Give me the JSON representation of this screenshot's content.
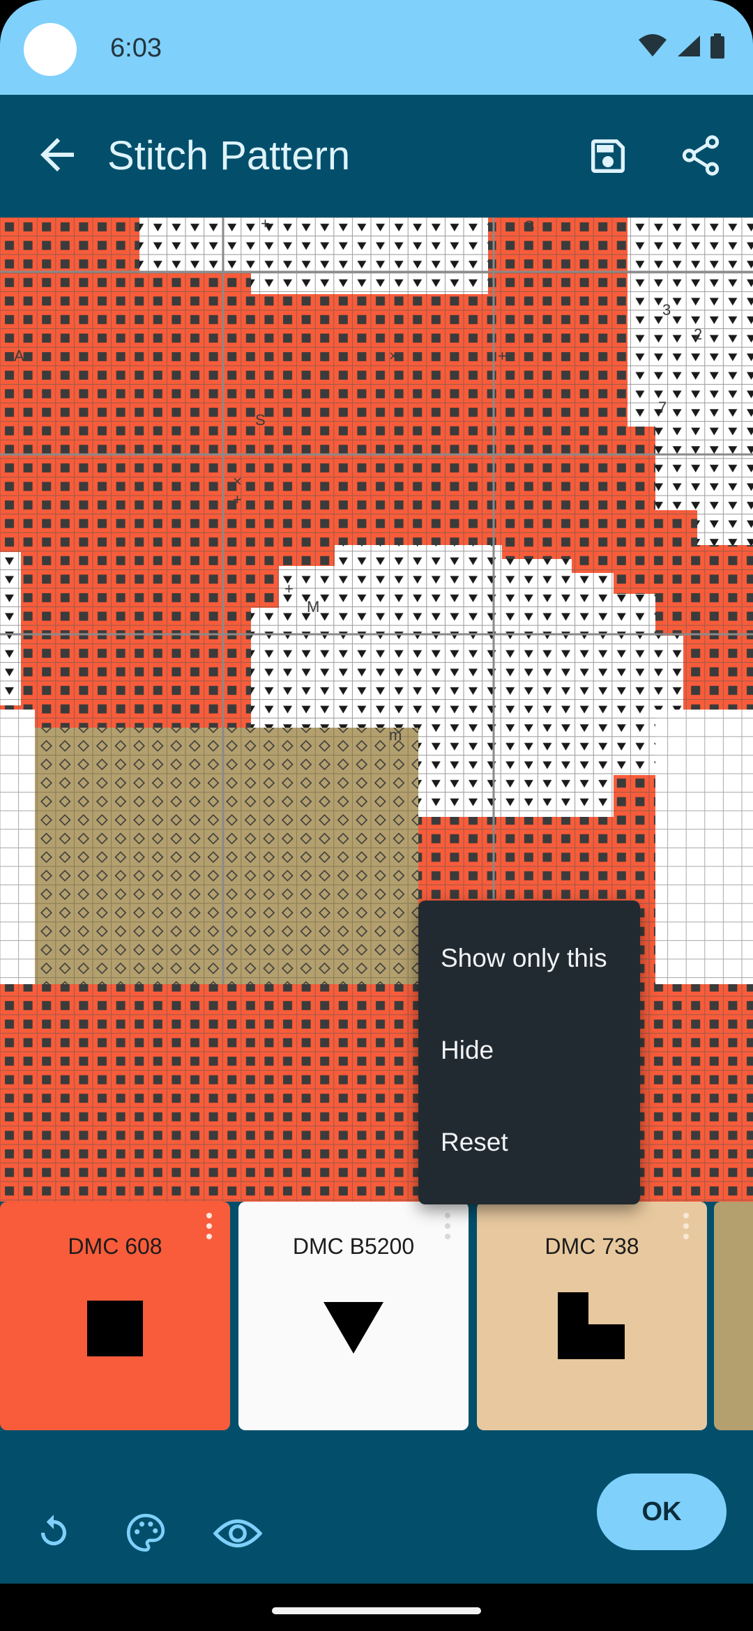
{
  "status": {
    "time": "6:03"
  },
  "appbar": {
    "title": "Stitch Pattern"
  },
  "menu": {
    "items": [
      "Show only this",
      "Hide",
      "Reset"
    ]
  },
  "palette": [
    {
      "label": "DMC 608",
      "color": "#f95c3a",
      "symbol": "square"
    },
    {
      "label": "DMC B5200",
      "color": "#fafafa",
      "symbol": "triangle"
    },
    {
      "label": "DMC 738",
      "color": "#e8c99f",
      "symbol": "l-shape"
    }
  ],
  "bottom": {
    "ok_label": "OK"
  },
  "colors": {
    "primary": "#034f6b",
    "accent": "#7fd0fb",
    "orange": "#f95c3a",
    "tan": "#b3a06e"
  }
}
